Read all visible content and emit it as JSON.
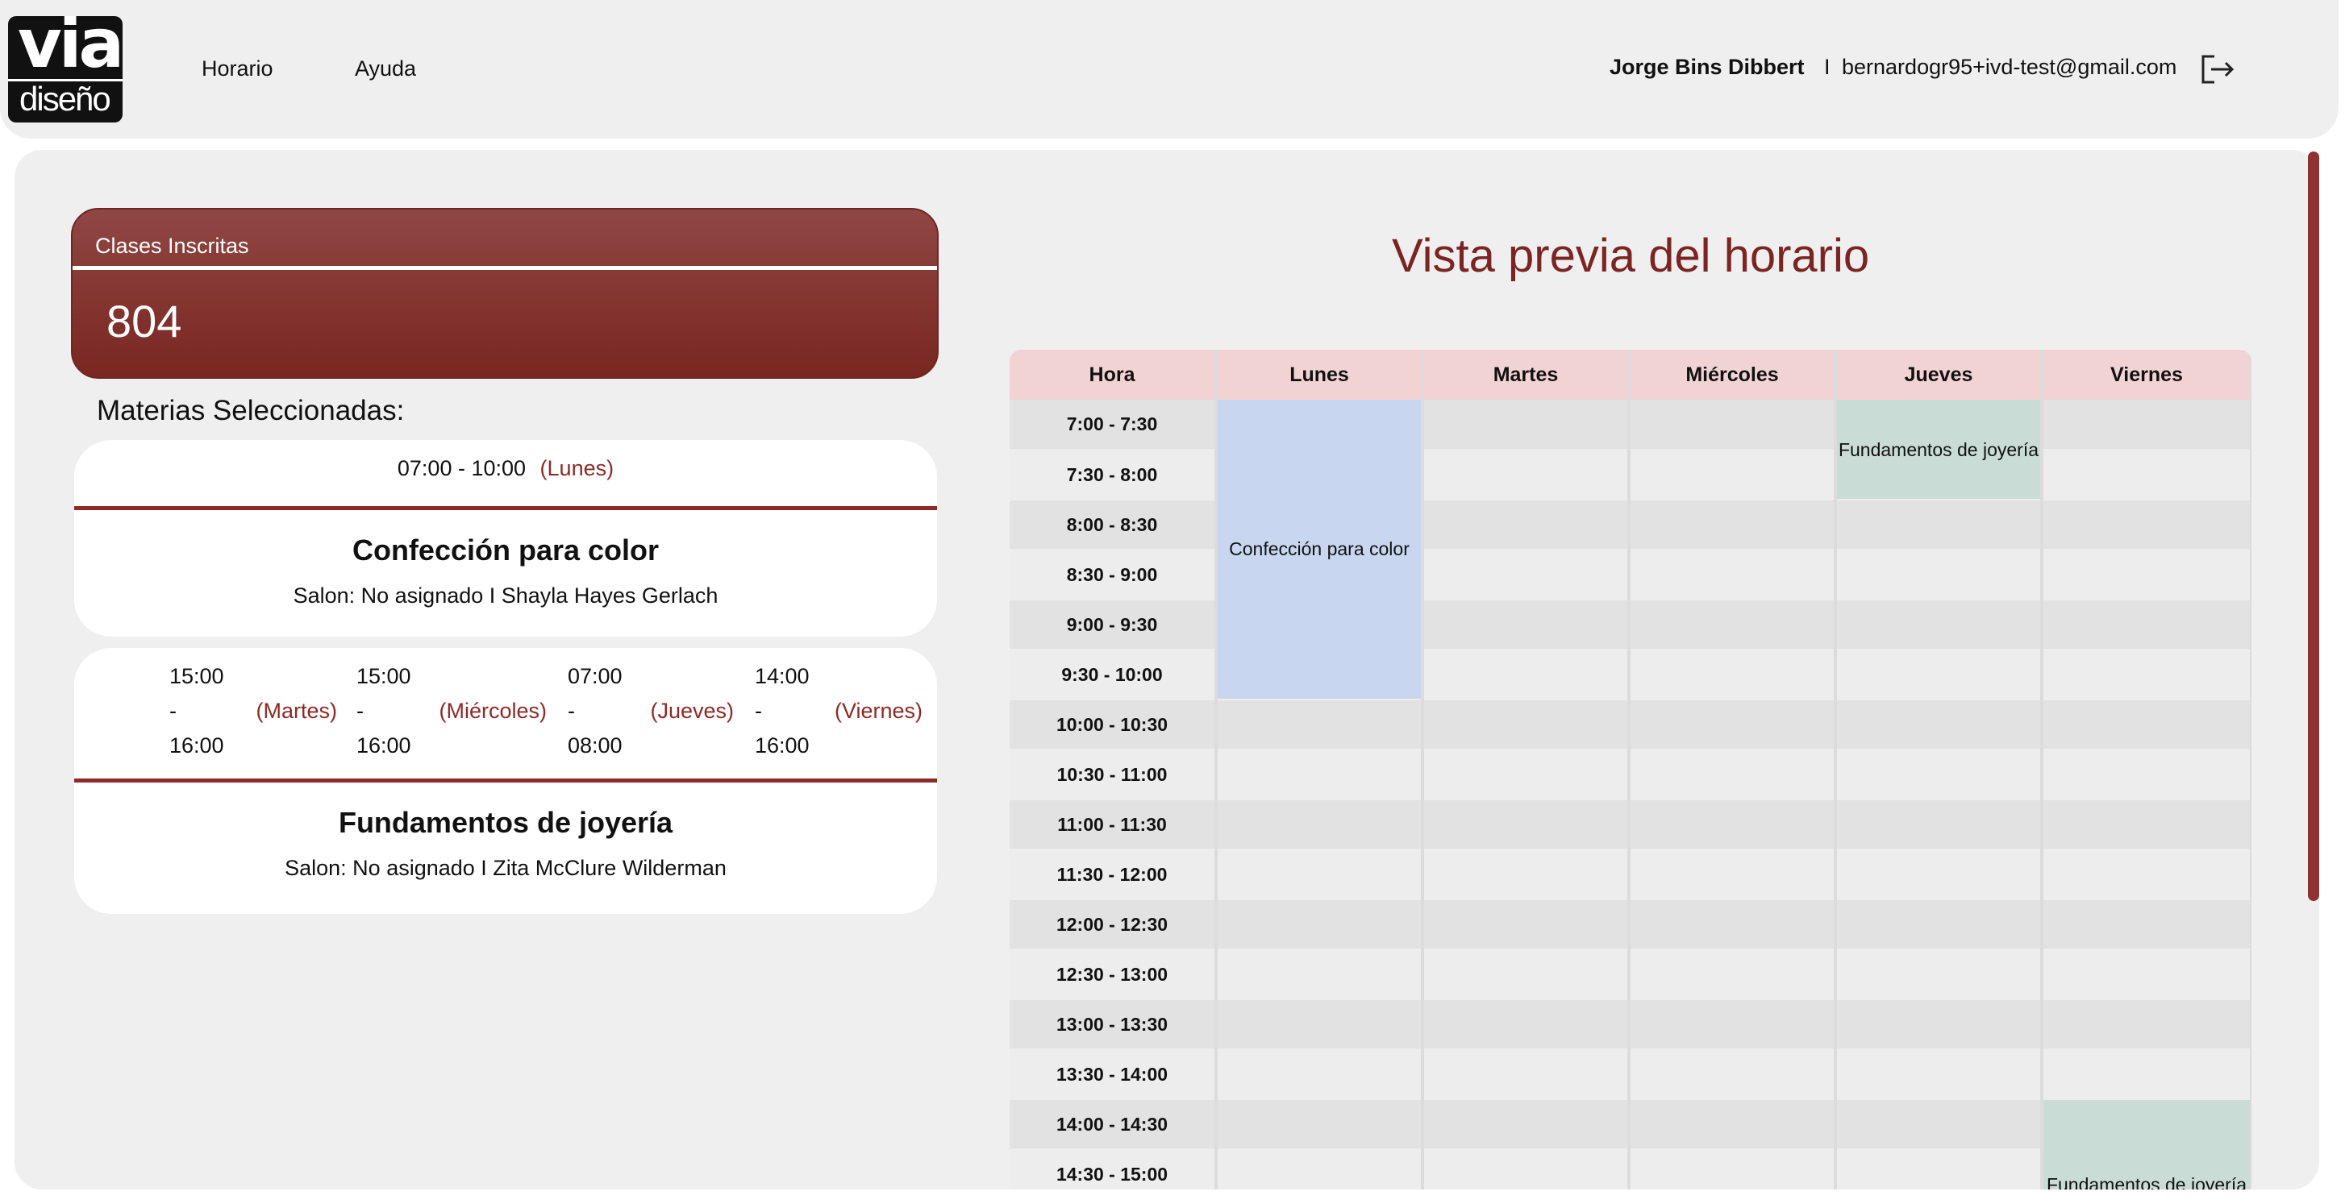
{
  "header": {
    "logo_top": "via",
    "logo_bottom": "diseño",
    "nav": [
      "Horario",
      "Ayuda"
    ],
    "user_name": "Jorge Bins Dibbert",
    "separator": "I",
    "user_email": "bernardogr95+ivd-test@gmail.com"
  },
  "stats": {
    "label": "Clases Inscritas",
    "value": "804"
  },
  "subjects_title": "Materias Seleccionadas:",
  "subjects": [
    {
      "schedule": [
        {
          "time": "07:00 - 10:00",
          "day": "(Lunes)"
        }
      ],
      "name": "Confección para color",
      "info": "Salon: No asignado I Shayla Hayes Gerlach"
    },
    {
      "schedule": [
        {
          "time": "15:00\n-\n16:00",
          "day": "(Martes)"
        },
        {
          "time": "15:00\n-\n16:00",
          "day": "(Miércoles)"
        },
        {
          "time": "07:00\n-\n08:00",
          "day": "(Jueves)"
        },
        {
          "time": "14:00\n-\n16:00",
          "day": "(Viernes)"
        }
      ],
      "name": "Fundamentos de joyería",
      "info": "Salon: No asignado I Zita McClure Wilderman"
    }
  ],
  "timetable": {
    "title": "Vista previa del horario",
    "headers": [
      "Hora",
      "Lunes",
      "Martes",
      "Miércoles",
      "Jueves",
      "Viernes"
    ],
    "hours": [
      "7:00 - 7:30",
      "7:30 - 8:00",
      "8:00 - 8:30",
      "8:30 - 9:00",
      "9:00 - 9:30",
      "9:30 - 10:00",
      "10:00 - 10:30",
      "10:30 - 11:00",
      "11:00 - 11:30",
      "11:30 - 12:00",
      "12:00 - 12:30",
      "12:30 - 13:00",
      "13:00 - 13:30",
      "13:30 - 14:00",
      "14:00 - 14:30",
      "14:30 - 15:00"
    ],
    "events": [
      {
        "label": "Confección para color",
        "day": "Lunes",
        "start": "7:00",
        "end": "10:00",
        "color": "#c8d6f0"
      },
      {
        "label": "Fundamentos de joyería",
        "day": "Jueves",
        "start": "7:00",
        "end": "8:00",
        "color": "#c9dcd5"
      },
      {
        "label": "Fundamentos de joyería",
        "day": "Viernes",
        "start": "14:00",
        "end": "16:00",
        "color": "#c9dcd5"
      }
    ]
  },
  "colors": {
    "accent": "#8e2a26",
    "header_row": "#f2d3d4"
  }
}
